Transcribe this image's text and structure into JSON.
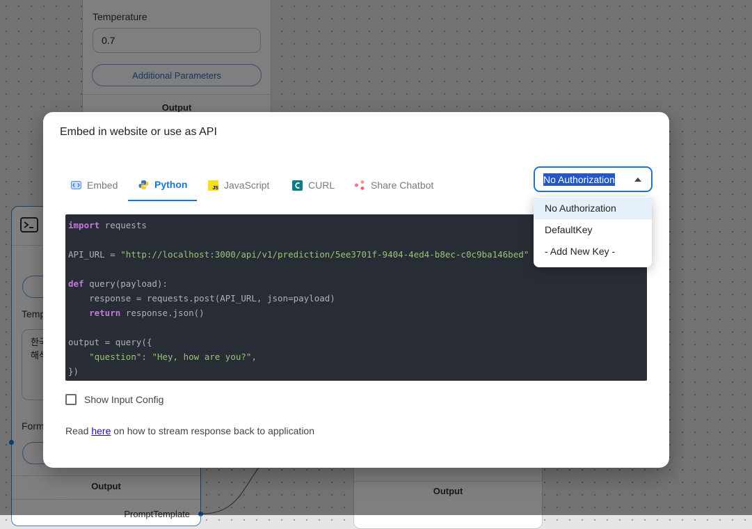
{
  "background": {
    "top_node": {
      "temperature_label": "Temperature",
      "temperature_value": "0.7",
      "additional_params_label": "Additional Parameters",
      "output_label": "Output"
    },
    "left_node": {
      "template_label": "Temp",
      "template_text": "한국\n해석",
      "format_label": "Form",
      "output_label": "Output",
      "output_type": "PromptTemplate"
    },
    "right_node": {
      "output_label": "Output"
    }
  },
  "modal": {
    "title": "Embed in website or use as API",
    "tabs": [
      {
        "label": "Embed",
        "icon": "embed-icon"
      },
      {
        "label": "Python",
        "icon": "python-icon",
        "active": true
      },
      {
        "label": "JavaScript",
        "icon": "javascript-icon"
      },
      {
        "label": "CURL",
        "icon": "curl-icon"
      },
      {
        "label": "Share Chatbot",
        "icon": "share-chatbot-icon"
      }
    ],
    "auth_select": {
      "value": "No Authorization"
    },
    "code": {
      "import_kw": "import",
      "import_rest": " requests",
      "api_url_prefix": "API_URL = ",
      "api_url_value": "\"http://localhost:3000/api/v1/prediction/5ee3701f-9404-4ed4-b8ec-c0c9ba146bed\"",
      "def_kw": "def",
      "def_rest": " query(payload):",
      "response_line": "    response = requests.post(API_URL, json=payload)",
      "return_indent": "    ",
      "return_kw": "return",
      "return_rest": " response.json()",
      "output_line": "output = query({",
      "question_indent": "    ",
      "question_key": "\"question\"",
      "question_colon": ": ",
      "question_value": "\"Hey, how are you?\"",
      "question_end": ",",
      "close_line": "})"
    },
    "show_input_config_label": "Show Input Config",
    "read_prefix": "Read ",
    "read_link": "here",
    "read_suffix": " on how to stream response back to application"
  },
  "auth_dropdown": {
    "options": [
      "No Authorization",
      "DefaultKey",
      "- Add New Key -"
    ],
    "selected": "No Authorization"
  },
  "colors": {
    "accent": "#1976d2",
    "code_bg": "#282c34",
    "keyword": "#c678dd",
    "string": "#98c379"
  }
}
